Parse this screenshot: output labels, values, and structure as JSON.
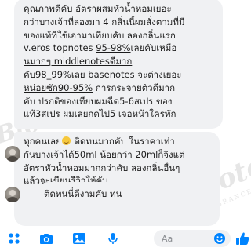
{
  "watermark": {
    "brand_left": "Blo",
    "brand_right": "Bloto",
    "sub": "FRAGRANCE"
  },
  "messages": {
    "review": {
      "lines": [
        "คุณภาพดีคับ อัตราผสมหัวน้ำหอมเยอะ",
        "กว่าบางเจ้าที่ลองมา 4 กลิ่นนี้ผมสั่งตามที่มี",
        "ของแท้ที่ใช้เอามาเทียบคับ ลองกลิ่นแรก",
        "v.eros topnotes ",
        "95-98%",
        "เลยคับเหมือ",
        "นมากๆ middlenotesดีมาก",
        "คับ98_99%เลย basenotes จะต่างเยอะ",
        "หน่อยซัก",
        "90-95%",
        " การกระจายตัวดีมาก",
        "คับ ปรกติของเทียบผมฉีด5-6สเปร ของ",
        "แท้3สเปร ผมเลยกดไป5 เจอหน้าใครทัก",
        "ทุกคนเลย",
        " ติดทนมากคับ ในราคาเท่า",
        "กันบางเจ้าได้50ml น้อยกว่า 20mlก็จิงแต่",
        "อัตราหัวน้ำหอมมากกว่าคับ ลองกลิ่นอื่นๆ",
        "แล้วจะเขียนรีวิวให้คับ"
      ]
    },
    "reply": {
      "text": "ติดทนนี่ดีงามคับ ทนจิง"
    }
  },
  "composer": {
    "placeholder": "Aa"
  },
  "icons": {
    "more": "four-dots-icon",
    "camera": "camera-icon",
    "gallery": "photo-icon",
    "mic": "microphone-icon",
    "emoji": "smiley-icon",
    "send": "thumbs-up-icon"
  },
  "colors": {
    "accent": "#0084ff",
    "bubble": "#f0f1f3",
    "text": "#1c1c1c"
  }
}
